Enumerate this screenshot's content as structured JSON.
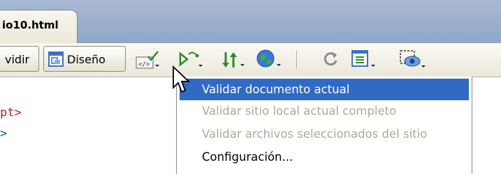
{
  "tab": {
    "title": "io10.html"
  },
  "toolbar": {
    "split_label": "vidir",
    "design_label": "Diseño",
    "icons": [
      "validate-markup-icon",
      "check-browser-icon",
      "file-management-icon",
      "preview-browser-icon",
      "refresh-icon",
      "view-options-icon",
      "visual-aids-icon"
    ]
  },
  "code": {
    "line1": "pt>",
    "line2": ">"
  },
  "menu": {
    "items": [
      {
        "label": "Validar documento actual",
        "state": "selected"
      },
      {
        "label": "Validar sitio local actual completo",
        "state": "disabled"
      },
      {
        "label": "Validar archivos seleccionados del sitio",
        "state": "disabled"
      },
      {
        "label": "Configuración...",
        "state": "enabled"
      }
    ]
  },
  "colors": {
    "selection": "#316ac5",
    "code_tag": "#b22222",
    "code_tag2": "#1f5aa6"
  }
}
